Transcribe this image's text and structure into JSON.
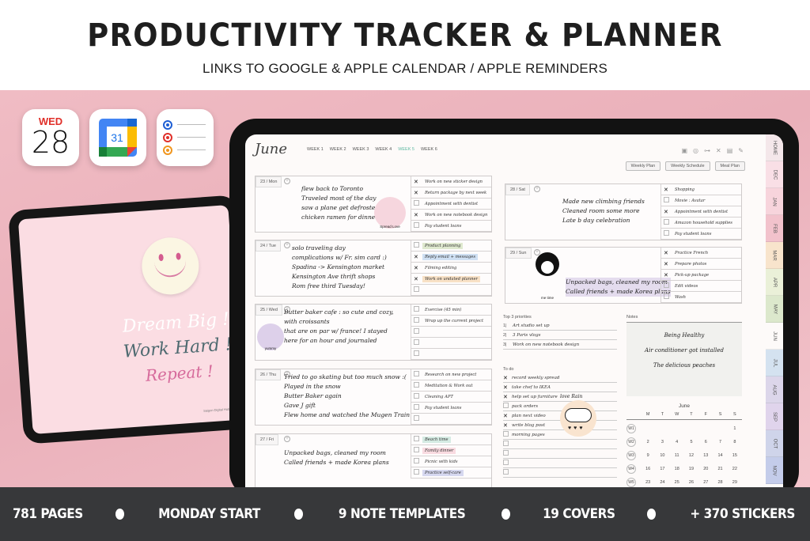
{
  "header": {
    "title": "PRODUCTIVITY TRACKER & PLANNER",
    "subtitle": "LINKS TO GOOGLE & APPLE CALENDAR / APPLE REMINDERS"
  },
  "app_icons": {
    "calendar": {
      "day": "WED",
      "date": "28"
    },
    "google_calendar": {
      "number": "31"
    },
    "reminders": {
      "dot_colors": [
        "#1e5fd4",
        "#e0302a",
        "#f0961e"
      ]
    }
  },
  "cover_ipad": {
    "quote_lines": [
      "Dream Big !",
      "Work Hard !",
      "Repeat !"
    ],
    "brand": "Saigon Digital Hub"
  },
  "planner": {
    "month": "June",
    "weeks": [
      {
        "label": "WEEK 1",
        "active": false
      },
      {
        "label": "WEEK 2",
        "active": false
      },
      {
        "label": "WEEK 3",
        "active": false
      },
      {
        "label": "WEEK 4",
        "active": false
      },
      {
        "label": "WEEK 5",
        "active": true
      },
      {
        "label": "WEEK 6",
        "active": false
      }
    ],
    "tool_icons": [
      "calendar-check-icon",
      "target-icon",
      "dumbbell-icon",
      "cutlery-icon",
      "notebook-icon",
      "pencil-icon"
    ],
    "view_buttons": [
      "Weekly Plan",
      "Weekly Schedule",
      "Meal Plan"
    ],
    "side_tabs": [
      {
        "label": "HOME",
        "color": "#f4e7ea"
      },
      {
        "label": "DEC",
        "color": "#f9dfe6"
      },
      {
        "label": "JAN",
        "color": "#f7d4dc"
      },
      {
        "label": "FEB",
        "color": "#f2c2cc"
      },
      {
        "label": "MAR",
        "color": "#f8e4cc"
      },
      {
        "label": "APR",
        "color": "#eaf0d8"
      },
      {
        "label": "MAY",
        "color": "#dce8cc"
      },
      {
        "label": "JUN",
        "color": "#fdfaf9"
      },
      {
        "label": "JUL",
        "color": "#d4e2f0"
      },
      {
        "label": "AUG",
        "color": "#dcd6ea"
      },
      {
        "label": "SEP",
        "color": "#e0d4ec"
      },
      {
        "label": "OCT",
        "color": "#cfd4ea"
      },
      {
        "label": "NOV",
        "color": "#c4ccea"
      }
    ],
    "days": [
      {
        "label": "23 / Mon",
        "journal": [
          "flew back to Toronto",
          "Traveled most of the day",
          "saw a plane get defrosted",
          "chicken ramen for dinner"
        ],
        "tasks": [
          {
            "text": "Work on new sticker design",
            "done": true
          },
          {
            "text": "Return package by next week",
            "done": true
          },
          {
            "text": "Appointment with dentist",
            "done": false
          },
          {
            "text": "Work on new notebook design",
            "done": true
          },
          {
            "text": "Pay student loans",
            "done": false
          }
        ],
        "sticker": "Spread Love"
      },
      {
        "label": "24 / Tue",
        "journal": [
          "solo traveling day",
          "complications w/ Fr. sim card :)",
          "Spadina -> Kensington market",
          "Kensington Ave thrift shops",
          "Rom free third Tuesday!"
        ],
        "tasks": [
          {
            "text": "Product planning",
            "done": false,
            "highlight": "#dfe9cf"
          },
          {
            "text": "Reply email + messages",
            "done": true,
            "highlight": "#cfe0f3"
          },
          {
            "text": "Filming editing",
            "done": true
          },
          {
            "text": "Work on undated planner",
            "done": true,
            "highlight": "#f8e1c6"
          },
          {
            "text": "",
            "done": false
          }
        ]
      },
      {
        "label": "25 / Wed",
        "journal": [
          "Butter baker cafe : so cute and cozy,",
          "with croissants",
          "that are on par w/ france! I stayed",
          "here for an hour and journaled"
        ],
        "tasks": [
          {
            "text": "Exercise (45 min)",
            "done": false
          },
          {
            "text": "Wrap up the current project",
            "done": false
          },
          {
            "text": "",
            "done": false
          },
          {
            "text": "",
            "done": false
          },
          {
            "text": "",
            "done": false
          }
        ],
        "sticker": "yummy"
      },
      {
        "label": "26 / Thu",
        "journal": [
          "Tried to go skating but too much snow :(",
          "Played in the snow",
          "Butter Baker again",
          "Gave J gift",
          "Flew home and watched the Mugen Train"
        ],
        "tasks": [
          {
            "text": "Research on new project",
            "done": false
          },
          {
            "text": "Meditation & Work out",
            "done": false
          },
          {
            "text": "Cleaning APT",
            "done": false
          },
          {
            "text": "Pay student loans",
            "done": false
          },
          {
            "text": "",
            "done": false
          }
        ]
      },
      {
        "label": "27 / Fri",
        "journal": [
          "Unpacked bags, cleaned my room",
          "Called friends + made Korea plans"
        ],
        "tasks": [
          {
            "text": "Beach time",
            "done": false,
            "highlight": "#d5ebe3"
          },
          {
            "text": "Family dinner",
            "done": false,
            "highlight": "#f9dbe1"
          },
          {
            "text": "Picnic with kids",
            "done": false
          },
          {
            "text": "Practice self-care",
            "done": false,
            "highlight": "#d6d8f0"
          }
        ]
      },
      {
        "label": "28 / Sat",
        "journal": [
          "Made new climbing friends",
          "Cleaned room some more",
          "Late b day celebration"
        ],
        "tasks": [
          {
            "text": "Shopping",
            "done": true
          },
          {
            "text": "Movie : Avatar",
            "done": false
          },
          {
            "text": "Appointment with dentist",
            "done": true
          },
          {
            "text": "Amazon household supplies",
            "done": false
          },
          {
            "text": "Pay student loans",
            "done": false
          }
        ]
      },
      {
        "label": "29 / Sun",
        "journal": [
          "Unpacked bags, cleaned my room",
          "Called friends + made Korea plans"
        ],
        "tasks": [
          {
            "text": "Practice French",
            "done": true
          },
          {
            "text": "Prepare photos",
            "done": true
          },
          {
            "text": "Pick-up package",
            "done": true
          },
          {
            "text": "Edit videos",
            "done": false
          },
          {
            "text": "Wash",
            "done": false
          }
        ],
        "sticker": "me time"
      }
    ],
    "priorities": {
      "heading": "Top 3 priorities",
      "items": [
        "Art studio set up",
        "3 Paris vlogs",
        "Work on new notebook design"
      ]
    },
    "todo": {
      "heading": "To do",
      "items": [
        {
          "text": "record weekly spread",
          "done": true
        },
        {
          "text": "take chef to IKEA",
          "done": true
        },
        {
          "text": "help set up furniture",
          "done": true
        },
        {
          "text": "pack orders",
          "done": false
        },
        {
          "text": "plan next video",
          "done": true
        },
        {
          "text": "write blog post",
          "done": true
        },
        {
          "text": "morning pages",
          "done": false
        }
      ],
      "sticker": "love Rain"
    },
    "notes": {
      "heading": "Notes",
      "lines": [
        "Being Healthy",
        "Air conditioner got installed",
        "The delicious peaches"
      ]
    },
    "mini_calendar": {
      "title": "June",
      "weekdays": [
        "M",
        "T",
        "W",
        "T",
        "F",
        "S",
        "S"
      ],
      "rows": [
        {
          "week": "W1",
          "days": [
            "",
            "",
            "",
            "",
            "",
            "",
            "1"
          ]
        },
        {
          "week": "W2",
          "days": [
            "2",
            "3",
            "4",
            "5",
            "6",
            "7",
            "8"
          ]
        },
        {
          "week": "W3",
          "days": [
            "9",
            "10",
            "11",
            "12",
            "13",
            "14",
            "15"
          ]
        },
        {
          "week": "W4",
          "days": [
            "16",
            "17",
            "18",
            "19",
            "20",
            "21",
            "22"
          ]
        },
        {
          "week": "W5",
          "days": [
            "23",
            "24",
            "25",
            "26",
            "27",
            "28",
            "29"
          ]
        }
      ]
    }
  },
  "features": [
    "781 PAGES",
    "MONDAY START",
    "9 NOTE TEMPLATES",
    "19 COVERS",
    "+ 370 STICKERS"
  ]
}
